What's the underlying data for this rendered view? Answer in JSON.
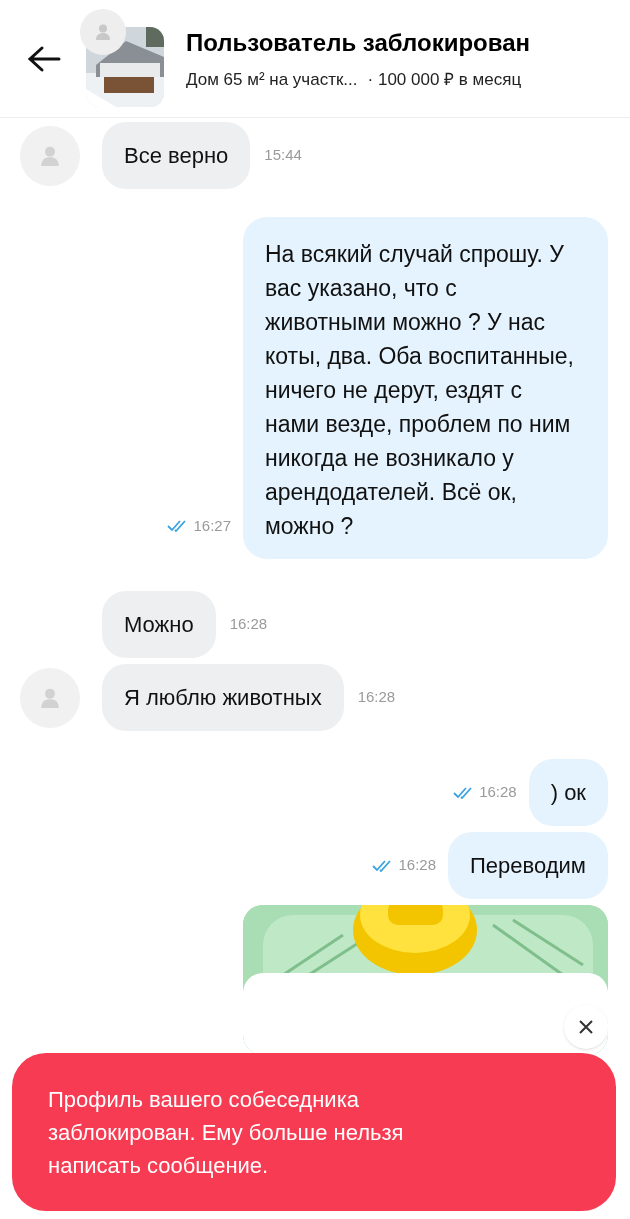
{
  "header": {
    "title": "Пользователь заблокирован",
    "listing": "Дом 65 м² на участк...",
    "price": "· 100 000 ₽ в месяц"
  },
  "messages": [
    {
      "kind": "incoming",
      "avatar": true,
      "text": "Все верно",
      "time": "15:44"
    },
    {
      "kind": "outgoing",
      "read": true,
      "text": "На всякий случай спрошу. У вас указано, что с животными можно ? У нас коты, два. Оба воспитанные, ничего не дерут, ездят с нами везде, проблем по ним никогда не возникало у арендодателей. Всё ок, можно ?",
      "time": "16:27"
    },
    {
      "kind": "incoming",
      "avatar": false,
      "text": "Можно",
      "time": "16:28"
    },
    {
      "kind": "incoming",
      "avatar": true,
      "text": "Я люблю животных",
      "time": "16:28"
    },
    {
      "kind": "outgoing",
      "read": true,
      "text": ") ок",
      "time": "16:28"
    },
    {
      "kind": "outgoing",
      "read": true,
      "text": "Переводим",
      "time": "16:28"
    },
    {
      "kind": "payment"
    }
  ],
  "toast": {
    "text": "Профиль вашего собеседника заблокирован. Ему больше нельзя написать сообщение."
  }
}
